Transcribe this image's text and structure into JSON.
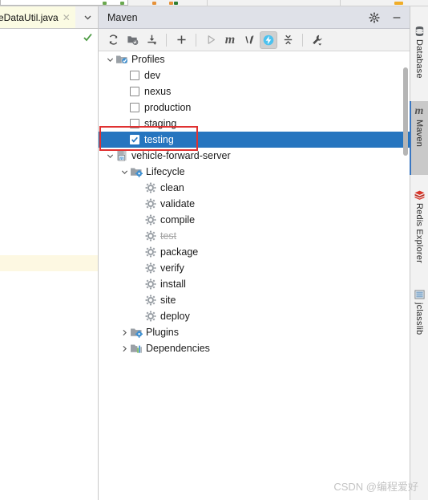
{
  "editor": {
    "tab": {
      "filename": "eDataUtil.java",
      "close_glyph": "✕"
    },
    "tab_chevron_icon": "chevron-down-icon",
    "gutter_status_icon": "check-mark-icon"
  },
  "maven": {
    "title": "Maven",
    "header_buttons": [
      {
        "name": "settings-button",
        "icon": "gear-icon",
        "glyph": "⚙"
      },
      {
        "name": "hide-button",
        "icon": "minimize-icon",
        "glyph": "—"
      }
    ],
    "toolbar": [
      {
        "name": "reload-all-projects-button",
        "icon": "refresh-icon",
        "state": "enabled"
      },
      {
        "name": "generate-sources-button",
        "icon": "folder-refresh-icon",
        "state": "enabled"
      },
      {
        "name": "download-sources-button",
        "icon": "download-icon",
        "state": "enabled"
      },
      {
        "name": "add-maven-project-button",
        "icon": "plus-icon",
        "state": "enabled"
      },
      {
        "name": "run-button",
        "icon": "play-triangle-icon",
        "state": "disabled"
      },
      {
        "name": "execute-maven-goal-button",
        "icon": "maven-m-icon",
        "label": "m",
        "state": "enabled"
      },
      {
        "name": "toggle-skip-tests-button",
        "icon": "skip-tests-icon",
        "state": "enabled"
      },
      {
        "name": "toggle-offline-mode-button",
        "icon": "lightning-bolt-icon",
        "state": "toggled-on"
      },
      {
        "name": "collapse-all-button",
        "icon": "collapse-all-icon",
        "state": "enabled"
      },
      {
        "name": "maven-settings-button",
        "icon": "wrench-dropdown-icon",
        "state": "enabled"
      }
    ],
    "tree": [
      {
        "indent": 0,
        "twisty": "expanded",
        "icon": "profiles-folder-icon",
        "label": "Profiles",
        "type": "folder",
        "selected": false
      },
      {
        "indent": 1,
        "twisty": "none",
        "icon": "checkbox-icon",
        "label": "dev",
        "type": "profile",
        "checked": false,
        "selected": false
      },
      {
        "indent": 1,
        "twisty": "none",
        "icon": "checkbox-icon",
        "label": "nexus",
        "type": "profile",
        "checked": false,
        "selected": false
      },
      {
        "indent": 1,
        "twisty": "none",
        "icon": "checkbox-icon",
        "label": "production",
        "type": "profile",
        "checked": false,
        "selected": false
      },
      {
        "indent": 1,
        "twisty": "none",
        "icon": "checkbox-icon",
        "label": "staging",
        "type": "profile",
        "checked": false,
        "selected": false
      },
      {
        "indent": 1,
        "twisty": "none",
        "icon": "checkbox-icon",
        "label": "testing",
        "type": "profile",
        "checked": true,
        "selected": true
      },
      {
        "indent": 0,
        "twisty": "expanded",
        "icon": "maven-project-icon",
        "label": "vehicle-forward-server",
        "type": "project",
        "selected": false
      },
      {
        "indent": 1,
        "twisty": "expanded",
        "icon": "lifecycle-folder-icon",
        "label": "Lifecycle",
        "type": "folder",
        "selected": false
      },
      {
        "indent": 2,
        "twisty": "none",
        "icon": "gear-goal-icon",
        "label": "clean",
        "type": "goal",
        "selected": false
      },
      {
        "indent": 2,
        "twisty": "none",
        "icon": "gear-goal-icon",
        "label": "validate",
        "type": "goal",
        "selected": false
      },
      {
        "indent": 2,
        "twisty": "none",
        "icon": "gear-goal-icon",
        "label": "compile",
        "type": "goal",
        "selected": false
      },
      {
        "indent": 2,
        "twisty": "none",
        "icon": "gear-goal-icon",
        "label": "test",
        "type": "goal",
        "selected": false,
        "disabled": true
      },
      {
        "indent": 2,
        "twisty": "none",
        "icon": "gear-goal-icon",
        "label": "package",
        "type": "goal",
        "selected": false
      },
      {
        "indent": 2,
        "twisty": "none",
        "icon": "gear-goal-icon",
        "label": "verify",
        "type": "goal",
        "selected": false
      },
      {
        "indent": 2,
        "twisty": "none",
        "icon": "gear-goal-icon",
        "label": "install",
        "type": "goal",
        "selected": false
      },
      {
        "indent": 2,
        "twisty": "none",
        "icon": "gear-goal-icon",
        "label": "site",
        "type": "goal",
        "selected": false
      },
      {
        "indent": 2,
        "twisty": "none",
        "icon": "gear-goal-icon",
        "label": "deploy",
        "type": "goal",
        "selected": false
      },
      {
        "indent": 1,
        "twisty": "collapsed",
        "icon": "plugins-folder-icon",
        "label": "Plugins",
        "type": "folder",
        "selected": false
      },
      {
        "indent": 1,
        "twisty": "collapsed",
        "icon": "dependencies-icon",
        "label": "Dependencies",
        "type": "folder",
        "selected": false
      }
    ]
  },
  "right_bar": [
    {
      "label": "Database",
      "icon": "database-icon",
      "active": false
    },
    {
      "label": "Maven",
      "icon": "maven-m-icon",
      "active": true
    },
    {
      "label": "Redis Explorer",
      "icon": "redis-icon",
      "active": false
    },
    {
      "label": "jclasslib",
      "icon": "jclasslib-icon",
      "active": false
    }
  ],
  "annotation": {
    "name": "red-highlight-rectangle",
    "color": "#e03131"
  },
  "watermark": {
    "text": "CSDN @编程爱好"
  },
  "colors": {
    "selection_blue": "#2675bf",
    "header_bg": "#dfe1e8",
    "toolbar_bg": "#f2f2f2",
    "tab_active_bg": "#fbfbe3",
    "annotation_red": "#e03131",
    "toggle_on_blue": "#3ec1f0"
  }
}
